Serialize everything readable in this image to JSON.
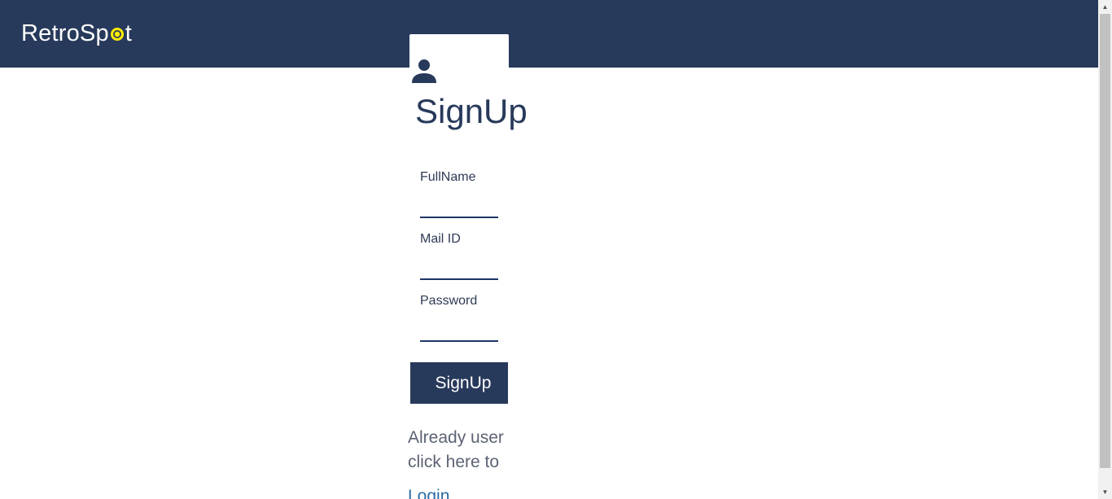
{
  "header": {
    "logo_prefix": "RetroSp",
    "logo_suffix": "t",
    "logo_dot_color": "#ffeb00",
    "background_color": "#283a5b"
  },
  "form": {
    "icon": "user-icon",
    "title": "SignUp",
    "fields": [
      {
        "label": "FullName",
        "value": ""
      },
      {
        "label": "Mail ID",
        "value": ""
      },
      {
        "label": "Password",
        "value": ""
      }
    ],
    "submit_label": "SignUp",
    "already_text": "Already user click here to",
    "login_link": "Login"
  },
  "scrollbar": {
    "up_icon": "scroll-up-arrow-icon",
    "down_icon": "scroll-down-arrow-icon"
  }
}
